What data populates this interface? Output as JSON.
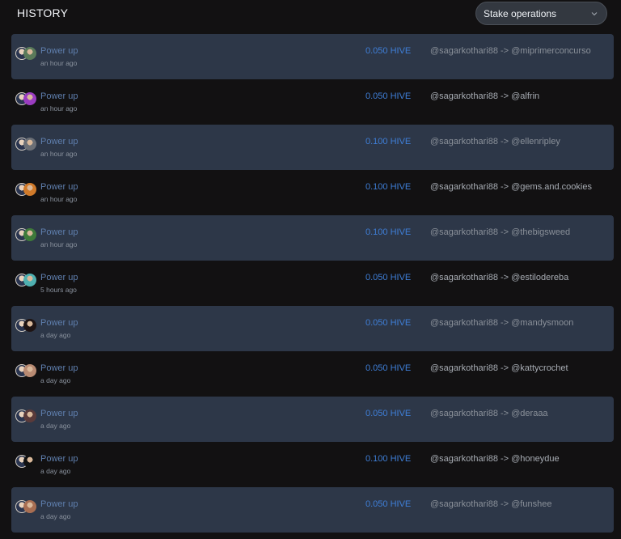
{
  "header": {
    "title": "HISTORY",
    "filter": {
      "selected": "Stake operations",
      "icon": "chevron-down-icon"
    }
  },
  "colors": {
    "page_bg": "#121112",
    "card_bg": "#2d3748",
    "amount": "#3f7fd8",
    "operation_link": "#5f7fae"
  },
  "history": [
    {
      "operation": "Power up",
      "time": "an hour ago",
      "amount": "0.050 HIVE",
      "transfer": "@sagarkothari88 -> @miprimerconcurso",
      "avatar_color": "#5a7a5a"
    },
    {
      "operation": "Power up",
      "time": "an hour ago",
      "amount": "0.050 HIVE",
      "transfer": "@sagarkothari88 -> @alfrin",
      "avatar_color": "#9a3cc0"
    },
    {
      "operation": "Power up",
      "time": "an hour ago",
      "amount": "0.100 HIVE",
      "transfer": "@sagarkothari88 -> @ellenripley",
      "avatar_color": "#6b6f76"
    },
    {
      "operation": "Power up",
      "time": "an hour ago",
      "amount": "0.100 HIVE",
      "transfer": "@sagarkothari88 -> @gems.and.cookies",
      "avatar_color": "#d07a2a"
    },
    {
      "operation": "Power up",
      "time": "an hour ago",
      "amount": "0.100 HIVE",
      "transfer": "@sagarkothari88 -> @thebigsweed",
      "avatar_color": "#3e7a3a"
    },
    {
      "operation": "Power up",
      "time": "5 hours ago",
      "amount": "0.050 HIVE",
      "transfer": "@sagarkothari88 -> @estilodereba",
      "avatar_color": "#4fb0b0"
    },
    {
      "operation": "Power up",
      "time": "a day ago",
      "amount": "0.050 HIVE",
      "transfer": "@sagarkothari88 -> @mandysmoon",
      "avatar_color": "#1e1414"
    },
    {
      "operation": "Power up",
      "time": "a day ago",
      "amount": "0.050 HIVE",
      "transfer": "@sagarkothari88 -> @kattycrochet",
      "avatar_color": "#b88a72"
    },
    {
      "operation": "Power up",
      "time": "a day ago",
      "amount": "0.050 HIVE",
      "transfer": "@sagarkothari88 -> @deraaa",
      "avatar_color": "#5a3a3a"
    },
    {
      "operation": "Power up",
      "time": "a day ago",
      "amount": "0.100 HIVE",
      "transfer": "@sagarkothari88 -> @honeydue",
      "avatar_color": "#111111"
    },
    {
      "operation": "Power up",
      "time": "a day ago",
      "amount": "0.050 HIVE",
      "transfer": "@sagarkothari88 -> @funshee",
      "avatar_color": "#a86e52"
    }
  ]
}
